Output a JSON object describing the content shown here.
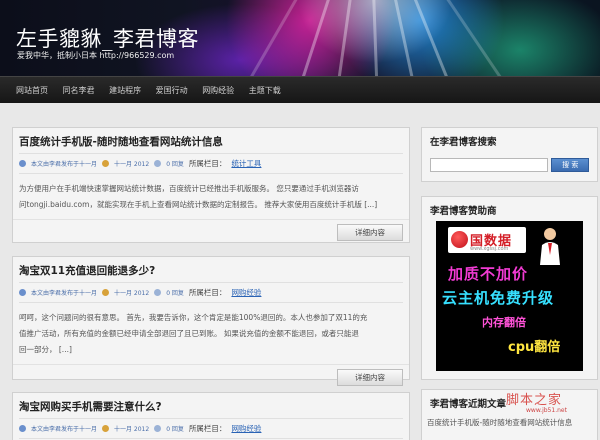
{
  "site": {
    "title": "左手貔貅_李君博客",
    "tagline": "爱我中华，抵制小日本  http://966529.com"
  },
  "nav": {
    "items": [
      "网站首页",
      "同名李君",
      "建站程序",
      "爱国行动",
      "网购经验",
      "主题下载"
    ]
  },
  "posts": [
    {
      "title": "百度统计手机版-随时随地查看网站统计信息",
      "author": "本文由李君发布于十一月",
      "date": "十一月 2012",
      "comments": "0 回复",
      "category_label": "所属栏目：",
      "category": "统计工具",
      "excerpt_line1": "为方便用户在手机端快速掌握网站统计数据，百度统计已经推出手机版服务。 您只要通过手机浏览器访",
      "excerpt_line2": "问tongji.baidu.com，就能实现在手机上查看网站统计数据的定制报告。 推荐大家使用百度统计手机版  [...]",
      "more": "详细内容"
    },
    {
      "title": "淘宝双11充值退回能退多少?",
      "author": "本文由李君发布于十一月",
      "date": "十一月 2012",
      "comments": "0 回复",
      "category_label": "所属栏目：",
      "category": "网购经验",
      "excerpt_line1": "呵呵，这个问题问的很有意思。 首先，我要告诉你，这个肯定是能100%退回的。本人也参加了双11的充",
      "excerpt_line2": "值推广活动，所有充值的金额已经申请全部退回了且已到账。 如果说充值的金额不能退回，或者只能退",
      "excerpt_line3": "回一部分，  [...]",
      "more": "详细内容"
    },
    {
      "title": "淘宝网购买手机需要注意什么?",
      "author": "本文由李君发布于十一月",
      "date": "十一月 2012",
      "comments": "0 回复",
      "category_label": "所属栏目：",
      "category": "网购经验"
    }
  ],
  "sidebar": {
    "search_title": "在李君博客搜索",
    "search_button": "搜 索",
    "search_value": "",
    "sponsor_title": "李君博客赞助商",
    "recent_title": "李君博客近期文章",
    "recent_first": "百度统计手机版-随时随地查看网站统计信息"
  },
  "ad": {
    "logo": "国数据",
    "logo_sub": "www.xgssj.com",
    "line1": "加质不加价",
    "line2": "云主机免费升级",
    "line3": "内存翻倍",
    "line4": "cpu翻倍"
  },
  "watermark": {
    "text": "脚本之家",
    "url": "www.jb51.net"
  },
  "colors": {
    "link": "#2a63b5",
    "nav_bg": "#1e1e1e",
    "search_button": "#3a6bb0"
  }
}
